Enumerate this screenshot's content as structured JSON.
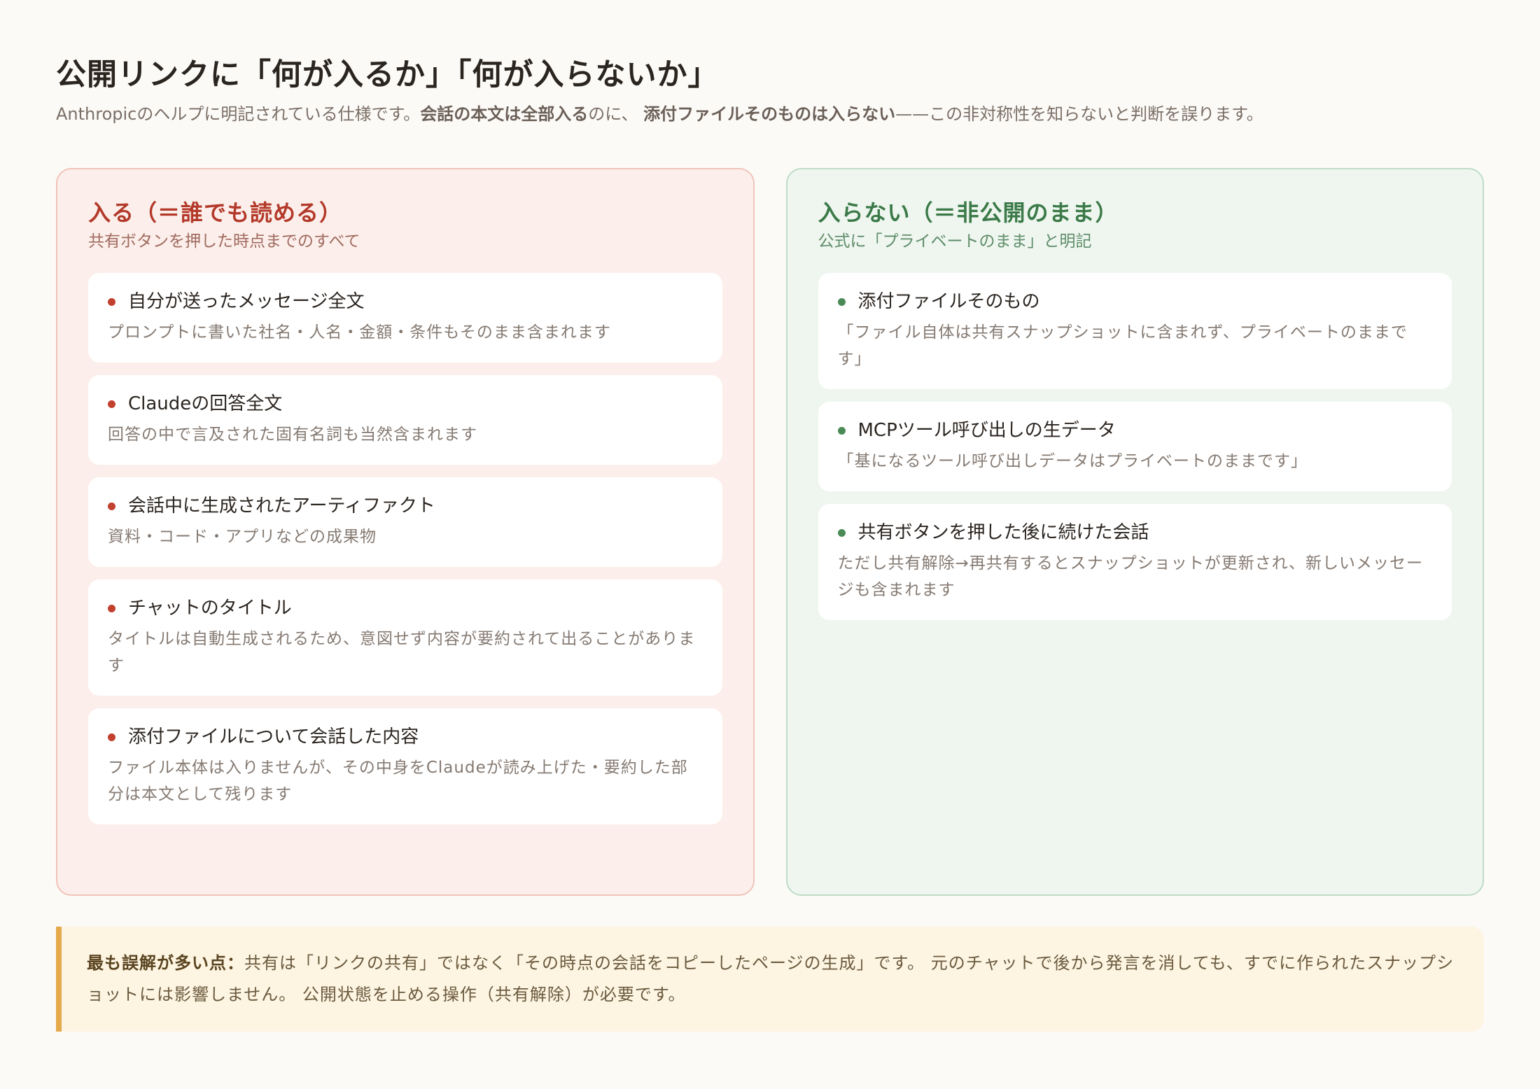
{
  "header": {
    "title": "公開リンクに「何が入るか」「何が入らないか」",
    "subtitle_prefix": "Anthropicのヘルプに明記されている仕様です。",
    "subtitle_bold1": "会話の本文は全部入る",
    "subtitle_mid": "のに、 ",
    "subtitle_bold2": "添付ファイルそのものは入らない",
    "subtitle_suffix": "——この非対称性を知らないと判断を誤ります。"
  },
  "included": {
    "heading": "入る（＝誰でも読める）",
    "subheading": "共有ボタンを押した時点までのすべて",
    "items": [
      {
        "title": "自分が送ったメッセージ全文",
        "desc": "プロンプトに書いた社名・人名・金額・条件もそのまま含まれます"
      },
      {
        "title": "Claudeの回答全文",
        "desc": "回答の中で言及された固有名詞も当然含まれます"
      },
      {
        "title": "会話中に生成されたアーティファクト",
        "desc": "資料・コード・アプリなどの成果物"
      },
      {
        "title": "チャットのタイトル",
        "desc": "タイトルは自動生成されるため、意図せず内容が要約されて出ることがあります"
      },
      {
        "title": "添付ファイルについて会話した内容",
        "desc": "ファイル本体は入りませんが、その中身をClaudeが読み上げた・要約した部分は本文として残ります"
      }
    ]
  },
  "excluded": {
    "heading": "入らない（＝非公開のまま）",
    "subheading": "公式に「プライベートのまま」と明記",
    "items": [
      {
        "title": "添付ファイルそのもの",
        "desc": "「ファイル自体は共有スナップショットに含まれず、プライベートのままです」"
      },
      {
        "title": "MCPツール呼び出しの生データ",
        "desc": "「基になるツール呼び出しデータはプライベートのままです」"
      },
      {
        "title": "共有ボタンを押した後に続けた会話",
        "desc": "ただし共有解除→再共有するとスナップショットが更新され、新しいメッセージも含まれます"
      }
    ]
  },
  "note": {
    "label": "最も誤解が多い点：",
    "text": "共有は「リンクの共有」ではなく「その時点の会話をコピーしたページの生成」です。 元のチャットで後から発言を消しても、すでに作られたスナップショットには影響しません。 公開状態を止める操作（共有解除）が必要です。"
  }
}
